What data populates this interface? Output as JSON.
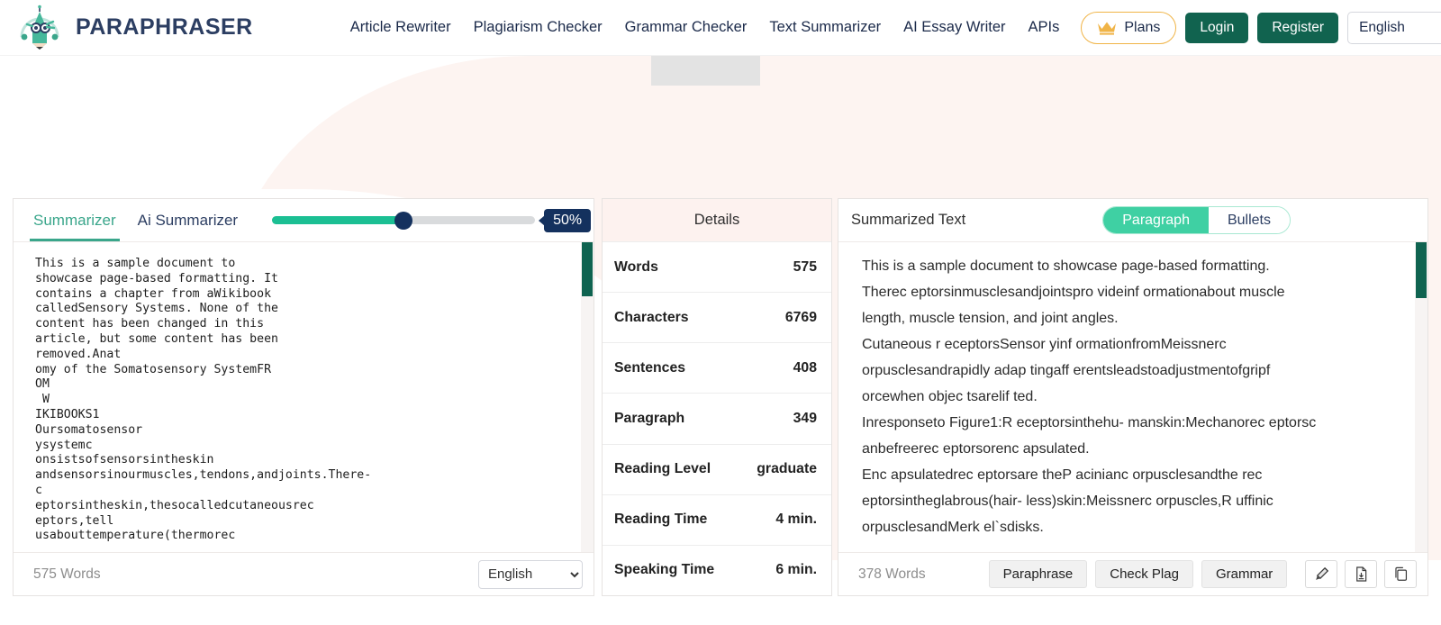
{
  "header": {
    "brand": "PARAPHRASER",
    "logo_icon": "owl-pencil-logo-icon",
    "nav": [
      {
        "label": "Article Rewriter",
        "name": "nav-article-rewriter"
      },
      {
        "label": "Plagiarism Checker",
        "name": "nav-plagiarism-checker"
      },
      {
        "label": "Grammar Checker",
        "name": "nav-grammar-checker"
      },
      {
        "label": "Text Summarizer",
        "name": "nav-text-summarizer"
      },
      {
        "label": "AI Essay Writer",
        "name": "nav-ai-essay-writer"
      },
      {
        "label": "APIs",
        "name": "nav-apis"
      }
    ],
    "plans_label": "Plans",
    "plans_icon": "crown-icon",
    "login_label": "Login",
    "register_label": "Register",
    "language": "English",
    "language_options": [
      "English"
    ]
  },
  "left_panel": {
    "tabs": [
      {
        "label": "Summarizer",
        "active": true
      },
      {
        "label": "Ai Summarizer",
        "active": false
      }
    ],
    "slider": {
      "value": 50,
      "badge": "50%",
      "percent": 50
    },
    "source_text": "This is a sample document to\nshowcase page-based formatting. It\ncontains a chapter from aWikibook\ncalledSensory Systems. None of the\ncontent has been changed in this\narticle, but some content has been\nremoved.Anat\nomy of the Somatosensory SystemFR\nOM\n W\nIKIBOOKS1\nOursomatosensor\nysystemc\nonsistsofsensorsintheskin\nandsensorsinourmuscles,tendons,andjoints.There-\nc\neptorsintheskin,thesocalledcutaneousrec\neptors,tell\nusabouttemperature(thermorec",
    "word_count": "575 Words",
    "footer_language": "English",
    "footer_language_options": [
      "English"
    ]
  },
  "details_panel": {
    "title": "Details",
    "rows": [
      {
        "label": "Words",
        "value": "575"
      },
      {
        "label": "Characters",
        "value": "6769"
      },
      {
        "label": "Sentences",
        "value": "408"
      },
      {
        "label": "Paragraph",
        "value": "349"
      },
      {
        "label": "Reading Level",
        "value": "graduate"
      },
      {
        "label": "Reading Time",
        "value": "4 min."
      },
      {
        "label": "Speaking Time",
        "value": "6 min."
      }
    ]
  },
  "right_panel": {
    "title": "Summarized Text",
    "view_modes": [
      {
        "label": "Paragraph",
        "active": true
      },
      {
        "label": "Bullets",
        "active": false
      }
    ],
    "summary_lines": [
      "This is a sample document to showcase page-based formatting.",
      "Therec eptorsinmusclesandjointspro videinf ormationabout muscle",
      "length, muscle tension, and joint angles.",
      "Cutaneous r eceptorsSensor yinf ormationfromMeissnerc",
      "orpusclesandrapidly adap tingaff erentsleadstoadjustmentofgripf",
      "orcewhen objec tsarelif ted.",
      "Inresponseto Figure1:R eceptorsinthehu- manskin:Mechanorec eptorsc",
      "anbefreerec eptorsorenc apsulated.",
      "Enc apsulatedrec eptorsare theP acinianc orpusclesandthe rec",
      "eptorsintheglabrous(hair- less)skin:Meissnerc orpuscles,R uffinic",
      "orpusclesandMerk el`sdisks."
    ],
    "word_count": "378 Words",
    "actions": [
      {
        "label": "Paraphrase",
        "name": "paraphrase-button"
      },
      {
        "label": "Check Plag",
        "name": "check-plagiarism-button"
      },
      {
        "label": "Grammar",
        "name": "grammar-button"
      }
    ],
    "icon_buttons": [
      {
        "icon": "highlighter-pen-icon",
        "name": "highlight-button"
      },
      {
        "icon": "download-document-icon",
        "name": "download-button"
      },
      {
        "icon": "copy-icon",
        "name": "copy-button"
      }
    ]
  },
  "colors": {
    "brand_navy": "#2c3e62",
    "accent_green": "#11634f",
    "teal": "#3aa68b",
    "mint": "#3fd0a3",
    "slider_fill": "#1bbf93",
    "slider_knob": "#14315e",
    "crown_gold": "#f0b447",
    "blob_pink": "#fdf4f1"
  }
}
